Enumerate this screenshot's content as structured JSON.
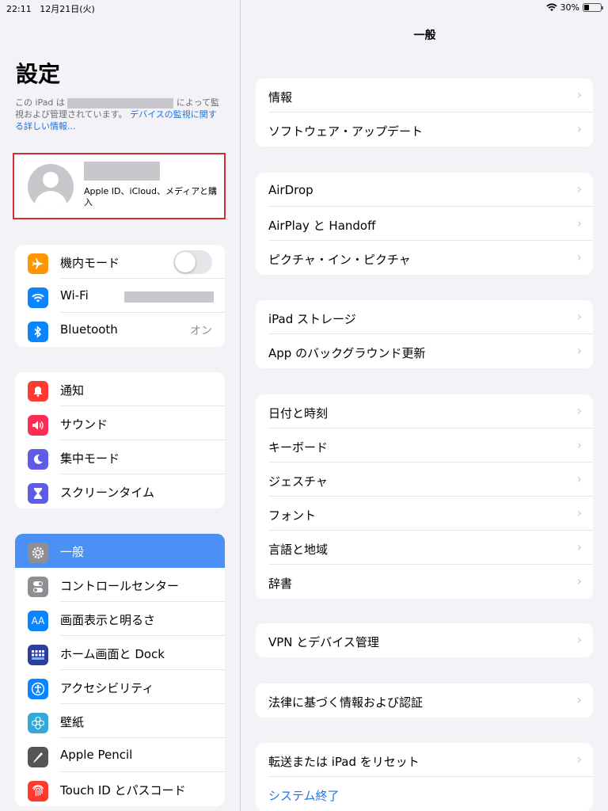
{
  "status": {
    "time": "22:11",
    "date": "12月21日(火)",
    "battery": "30%",
    "battery_level": 0.3
  },
  "sidebar": {
    "title": "設定",
    "supervision_prefix": "この iPad は",
    "supervision_suffix": "によって監視および管理されています。",
    "supervision_link": "デバイスの監視に関する詳しい情報...",
    "account_sub": "Apple ID、iCloud、メディアと購入",
    "group1": [
      {
        "label": "機内モード",
        "icon": "airplane-icon",
        "color": "#ff9500"
      },
      {
        "label": "Wi-Fi",
        "icon": "wifi-icon",
        "color": "#0a84ff"
      },
      {
        "label": "Bluetooth",
        "icon": "bluetooth-icon",
        "color": "#0a84ff",
        "value": "オン"
      }
    ],
    "group2": [
      {
        "label": "通知",
        "icon": "bell-icon",
        "color": "#ff3b30"
      },
      {
        "label": "サウンド",
        "icon": "speaker-icon",
        "color": "#ff2d55"
      },
      {
        "label": "集中モード",
        "icon": "moon-icon",
        "color": "#5e5ce6"
      },
      {
        "label": "スクリーンタイム",
        "icon": "hourglass-icon",
        "color": "#5e5ce6"
      }
    ],
    "group3": [
      {
        "label": "一般",
        "icon": "gear-icon",
        "color": "#8e8e93"
      },
      {
        "label": "コントロールセンター",
        "icon": "switches-icon",
        "color": "#8e8e93"
      },
      {
        "label": "画面表示と明るさ",
        "icon": "aa-icon",
        "icon_text": "AA",
        "color": "#0a84ff"
      },
      {
        "label": "ホーム画面と Dock",
        "icon": "grid-icon",
        "color": "#2c3e9f"
      },
      {
        "label": "アクセシビリティ",
        "icon": "accessibility-icon",
        "color": "#0a84ff"
      },
      {
        "label": "壁紙",
        "icon": "flower-icon",
        "color": "#34aadc"
      },
      {
        "label": "Apple Pencil",
        "icon": "pencil-icon",
        "color": "#555555"
      },
      {
        "label": "Touch ID とパスコード",
        "icon": "fingerprint-icon",
        "color": "#ff3b30"
      }
    ]
  },
  "content": {
    "title": "一般",
    "groups": [
      [
        "情報",
        "ソフトウェア・アップデート"
      ],
      [
        "AirDrop",
        "AirPlay と Handoff",
        "ピクチャ・イン・ピクチャ"
      ],
      [
        "iPad ストレージ",
        "App のバックグラウンド更新"
      ],
      [
        "日付と時刻",
        "キーボード",
        "ジェスチャ",
        "フォント",
        "言語と地域",
        "辞書"
      ],
      [
        "VPN とデバイス管理"
      ],
      [
        "法律に基づく情報および認証"
      ],
      [
        "転送または iPad をリセット",
        "システム終了"
      ]
    ],
    "chevron": "›"
  }
}
